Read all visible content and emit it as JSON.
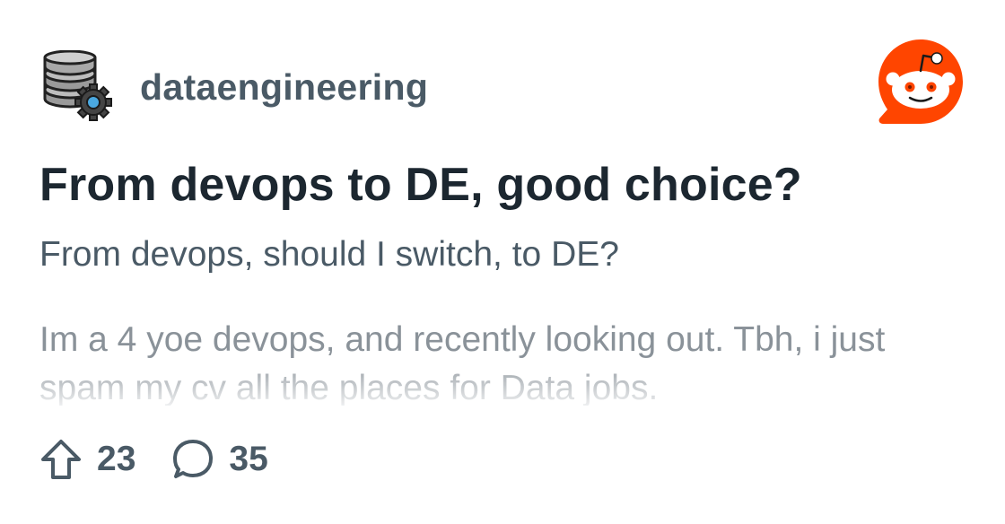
{
  "subreddit": {
    "name": "dataengineering",
    "avatar_icon": "database-gear-icon"
  },
  "brand": {
    "logo_icon": "reddit-snoo-logo",
    "color": "#ff4500"
  },
  "post": {
    "title": "From devops to DE, good choice?",
    "subtitle": "From devops, should I switch, to DE?",
    "body": "Im a 4 yoe devops, and recently looking out. Tbh, i just spam my cv all the places for Data jobs."
  },
  "stats": {
    "upvotes": "23",
    "upvote_icon": "upvote-arrow-icon",
    "comments": "35",
    "comment_icon": "comment-bubble-icon"
  }
}
